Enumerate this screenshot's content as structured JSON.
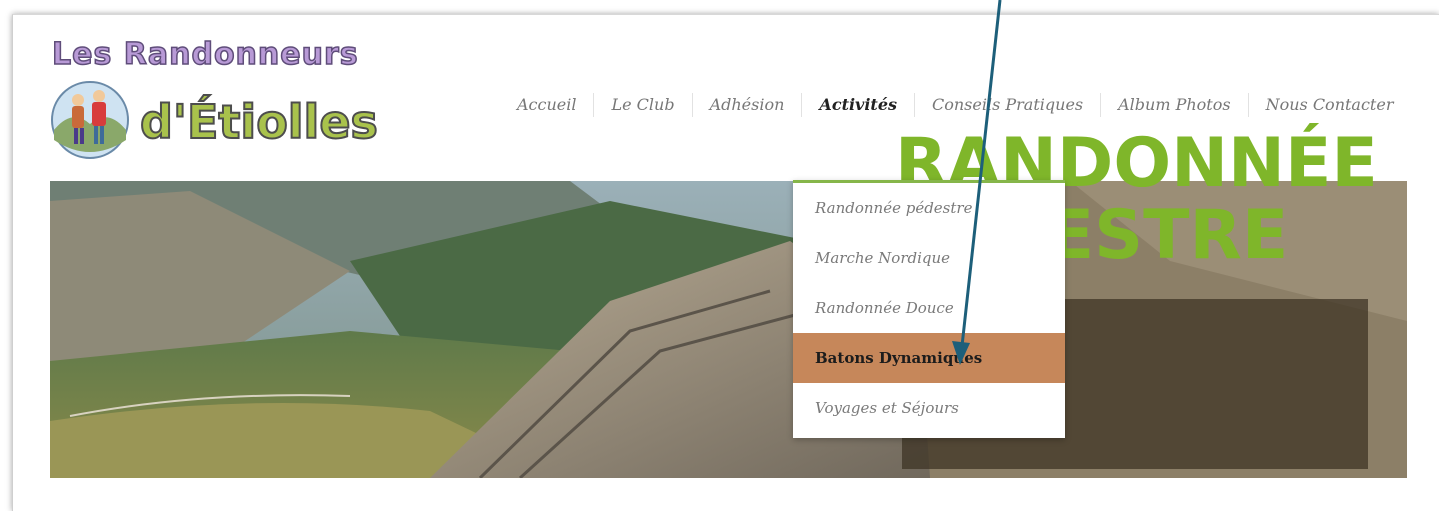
{
  "site": {
    "logo_line1": "Les Randonneurs",
    "logo_line2": "d'Étiolles"
  },
  "nav": {
    "items": [
      {
        "label": "Accueil"
      },
      {
        "label": "Le Club"
      },
      {
        "label": "Adhésion"
      },
      {
        "label": "Activités"
      },
      {
        "label": "Conseils Pratiques"
      },
      {
        "label": "Album Photos"
      },
      {
        "label": "Nous Contacter"
      }
    ],
    "active": "Activités"
  },
  "dropdown": {
    "items": [
      {
        "label": "Randonnée pédestre"
      },
      {
        "label": "Marche Nordique"
      },
      {
        "label": "Randonnée Douce"
      },
      {
        "label": "Batons Dynamiques"
      },
      {
        "label": "Voyages et Séjours"
      }
    ],
    "highlighted": "Batons Dynamiques"
  },
  "hero": {
    "banner_text": "RANDONNÉE\nPÉDESTRE"
  },
  "colors": {
    "accent_green": "#86b64a",
    "highlight": "#c6875a",
    "banner_text": "#7fb62a",
    "annotation_arrow": "#1d5f7a"
  }
}
